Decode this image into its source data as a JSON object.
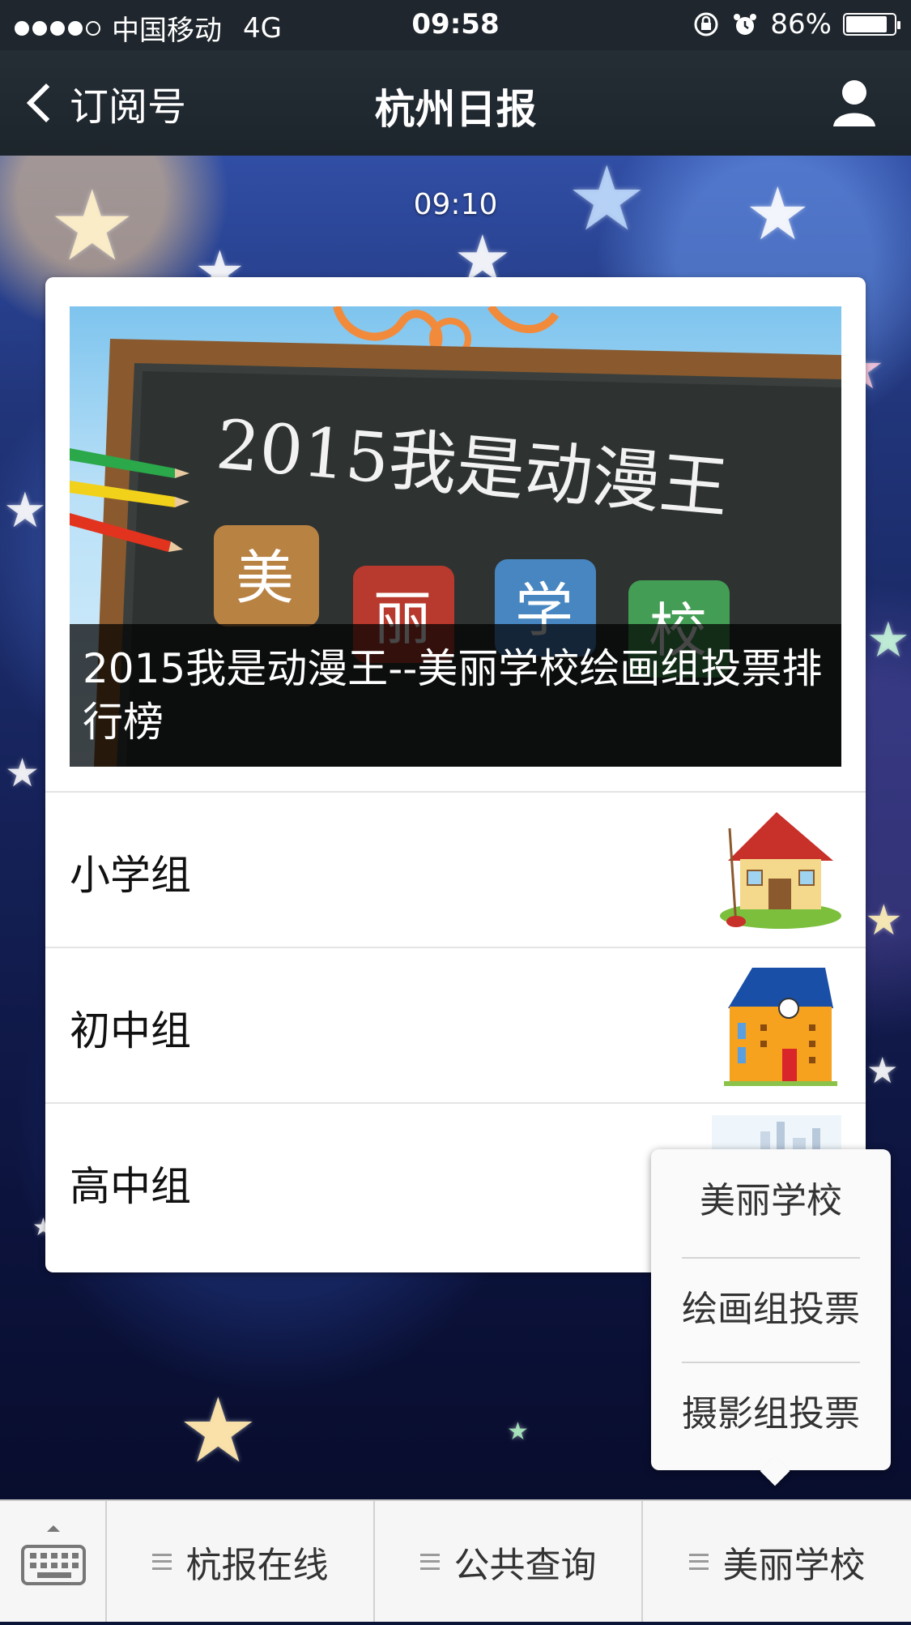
{
  "status_bar": {
    "carrier": "中国移动",
    "network": "4G",
    "time": "09:58",
    "battery_percent": "86%",
    "battery_level": 0.86
  },
  "nav": {
    "back_label": "订阅号",
    "title": "杭州日报"
  },
  "chat": {
    "timestamp": "09:10"
  },
  "article": {
    "cover_title": "2015我是动漫王--美丽学校绘画组投票排行榜",
    "cover_art_text": "2015我是动漫王",
    "cover_art_chars": [
      "美",
      "丽",
      "学",
      "校"
    ],
    "items": [
      {
        "label": "小学组",
        "thumb": "house-illustration"
      },
      {
        "label": "初中组",
        "thumb": "school-building-illustration"
      },
      {
        "label": "高中组",
        "thumb": "city-skyline-illustration"
      }
    ]
  },
  "popup_menu": {
    "items": [
      "美丽学校",
      "绘画组投票",
      "摄影组投票"
    ]
  },
  "bottom_menu": {
    "keyboard_icon": "keyboard-icon",
    "tabs": [
      "杭报在线",
      "公共查询",
      "美丽学校"
    ]
  },
  "colors": {
    "header_bg": "#1f262d",
    "caption_overlay": "rgba(0,0,0,0.72)",
    "card_bg": "#ffffff",
    "bottom_bar_bg": "#f6f6f6"
  }
}
